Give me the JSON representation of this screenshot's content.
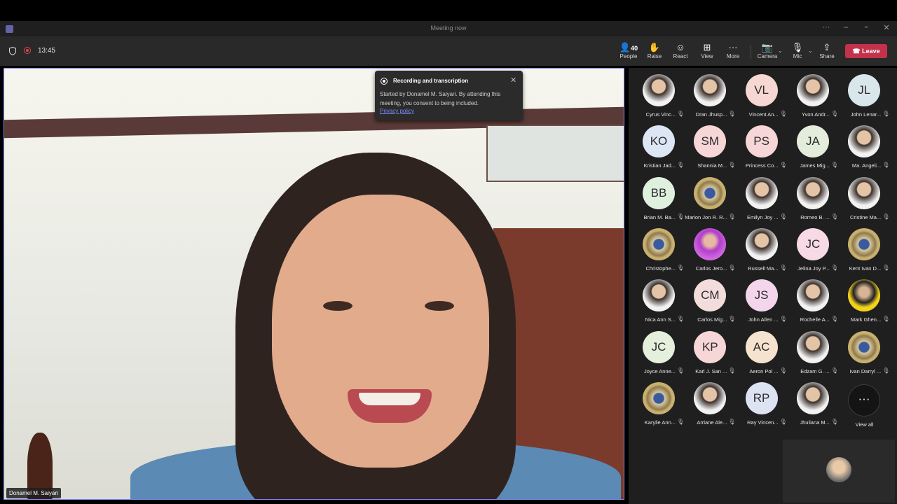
{
  "window": {
    "title": "Meeting now"
  },
  "toolbar": {
    "timer": "13:45",
    "people_count": "40",
    "people_label": "People",
    "raise_label": "Raise",
    "react_label": "React",
    "view_label": "View",
    "more_label": "More",
    "camera_label": "Camera",
    "mic_label": "Mic",
    "share_label": "Share",
    "leave_label": "Leave"
  },
  "stage": {
    "speaker_name": "Donamel M. Saiyari"
  },
  "toast": {
    "title": "Recording and transcription",
    "body": "Started by Donamel M. Saiyari. By attending this meeting, you consent to being included.",
    "link": "Privacy policy"
  },
  "colors": {
    "accent": "#7f85f5",
    "leave": "#c4314b",
    "panel": "#1f1f1f"
  },
  "participants": [
    {
      "name": "Cyrus Vinc...",
      "initials": "",
      "photo": "photo"
    },
    {
      "name": "Dran Jhusp...",
      "initials": "",
      "photo": "photo"
    },
    {
      "name": "Vincent An...",
      "initials": "VL",
      "color": "#f6d7d2"
    },
    {
      "name": "Yvon Andr...",
      "initials": "",
      "photo": "photo"
    },
    {
      "name": "John Lenar...",
      "initials": "JL",
      "color": "#d9e7ec"
    },
    {
      "name": "Kristian Jad...",
      "initials": "KO",
      "color": "#dce6f5"
    },
    {
      "name": "Shannia M...",
      "initials": "SM",
      "color": "#f6d6d6"
    },
    {
      "name": "Princess Co...",
      "initials": "PS",
      "color": "#f6d6d6"
    },
    {
      "name": "James Mig...",
      "initials": "JA",
      "color": "#e4eddb"
    },
    {
      "name": "Ma. Angeli...",
      "initials": "",
      "photo": "photo"
    },
    {
      "name": "Brian M. Ba...",
      "initials": "BB",
      "color": "#dff0df"
    },
    {
      "name": "Marion Jon R. R...",
      "initials": "",
      "photo": "seal"
    },
    {
      "name": "Emilyn Joy ...",
      "initials": "",
      "photo": "photo"
    },
    {
      "name": "Romeo B. ...",
      "initials": "",
      "photo": "photo"
    },
    {
      "name": "Cristine Ma...",
      "initials": "",
      "photo": "photo"
    },
    {
      "name": "Christophe...",
      "initials": "",
      "photo": "seal"
    },
    {
      "name": "Carlos Jero...",
      "initials": "",
      "photo": "purple"
    },
    {
      "name": "Russell Ma...",
      "initials": "",
      "photo": "photo"
    },
    {
      "name": "Jelina Joy P...",
      "initials": "JC",
      "color": "#f8d9e6"
    },
    {
      "name": "Kent Ivan D...",
      "initials": "",
      "photo": "seal"
    },
    {
      "name": "Nica Ann S...",
      "initials": "",
      "photo": "photo"
    },
    {
      "name": "Carlos Mig...",
      "initials": "CM",
      "color": "#f3dcdc"
    },
    {
      "name": "John Allen ...",
      "initials": "JS",
      "color": "#f3d6ec"
    },
    {
      "name": "Rochelle A...",
      "initials": "",
      "photo": "photo"
    },
    {
      "name": "Mark Ghen...",
      "initials": "",
      "photo": "yellow"
    },
    {
      "name": "Joyce Anne...",
      "initials": "JC",
      "color": "#e4f0dc"
    },
    {
      "name": "Karl J. San ...",
      "initials": "KP",
      "color": "#f6d6d6"
    },
    {
      "name": "Aeron Pol ...",
      "initials": "AC",
      "color": "#f6e3cf"
    },
    {
      "name": "Edzam G. ...",
      "initials": "",
      "photo": "photo"
    },
    {
      "name": "Ivan Darryl ...",
      "initials": "",
      "photo": "seal"
    },
    {
      "name": "Karylle Ann...",
      "initials": "",
      "photo": "seal"
    },
    {
      "name": "Arriane Ale...",
      "initials": "",
      "photo": "photo"
    },
    {
      "name": "Ray Vincen...",
      "initials": "RP",
      "color": "#dde3f3"
    },
    {
      "name": "Jhuliana M...",
      "initials": "",
      "photo": "photo"
    }
  ],
  "view_all": {
    "label": "View all"
  }
}
